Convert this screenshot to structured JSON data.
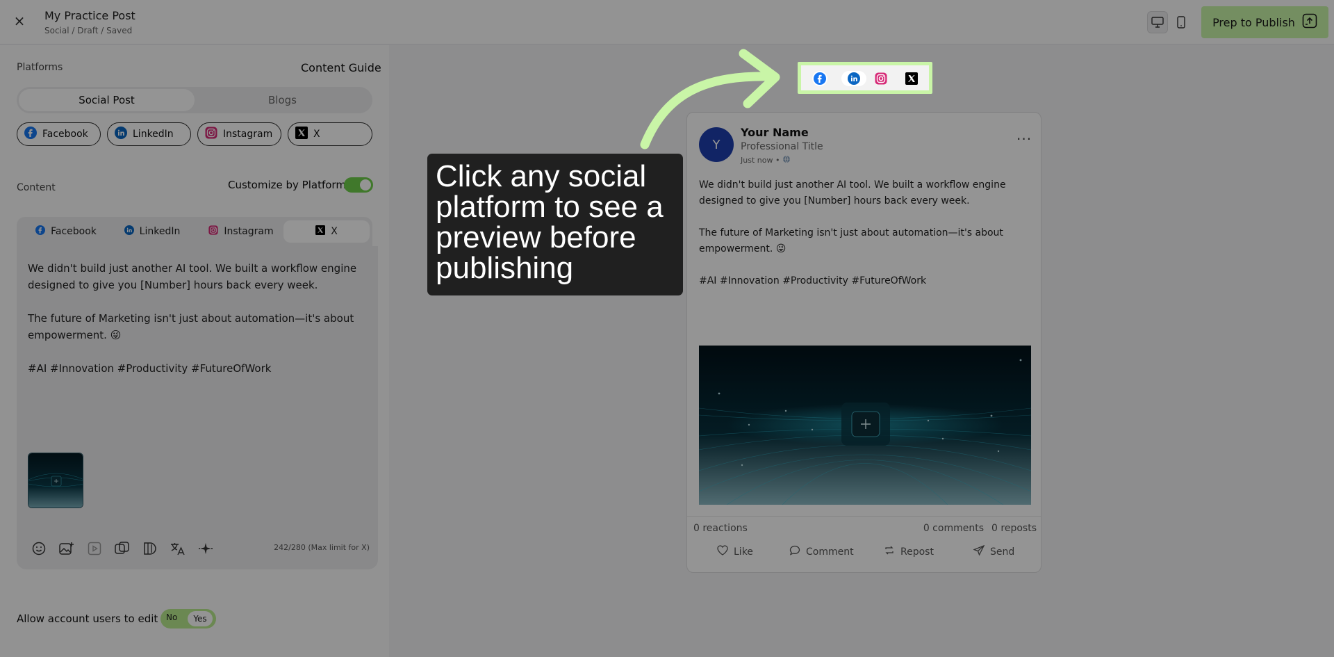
{
  "header": {
    "close_icon": "×",
    "title": "My Practice Post",
    "breadcrumb": "Social / Draft / Saved",
    "view_icons": [
      "desktop-icon",
      "mobile-icon"
    ],
    "prep_button": "Prep to Publish",
    "prep_color": "#c9f5a7"
  },
  "left": {
    "platforms_label": "Platforms",
    "content_guide": "Content Guide",
    "segments": [
      "Social Post",
      "Blogs"
    ],
    "platform_chips": [
      "Facebook",
      "LinkedIn",
      "Instagram",
      "X"
    ],
    "content_label": "Content",
    "customize_label": "Customize by Platform",
    "customize_on": true,
    "tabs": [
      "Facebook",
      "LinkedIn",
      "Instagram",
      "X"
    ],
    "active_tab": "X",
    "editor_lines": [
      "We didn't build just another AI tool. We built a workflow engine designed to give you [Number] hours back every week.",
      "",
      "The future of Marketing isn't just about automation—it's about empowerment. 😜",
      "",
      "#AI #Innovation #Productivity #FutureOfWork"
    ],
    "tool_icons": [
      "emoji-icon",
      "add-image-icon",
      "video-icon",
      "duplicate-icon",
      "gif-icon",
      "translate-icon",
      "ai-sparkle-icon"
    ],
    "char_count": "242/280 (Max limit for X)",
    "allow_label": "Allow account users to edit",
    "allow_no": "No",
    "allow_yes": "Yes"
  },
  "preview": {
    "avatar_letter": "Y",
    "name": "Your Name",
    "title": "Professional Title",
    "time": "Just now •",
    "more": "···",
    "body": [
      "We didn't build just another AI tool. We built a workflow engine designed to give you [Number] hours back every week.",
      "",
      "The future of Marketing isn't just about automation—it's about empowerment. 😜",
      "",
      "#AI #Innovation #Productivity #FutureOfWork"
    ],
    "reactions": "0 reactions",
    "comments": "0 comments",
    "reposts": "0 reposts",
    "actions": [
      "Like",
      "Comment",
      "Repost",
      "Send"
    ]
  },
  "tooltip": {
    "text": "Click any social platform to see a preview before publishing"
  },
  "colors": {
    "facebook": "#1877f2",
    "linkedin": "#0a66c2",
    "instagram": "#d62976",
    "x": "#000000",
    "accent_green": "#c9f5a7",
    "toggle_green": "#6ecf4a",
    "avatar_blue": "#1e3fae"
  }
}
